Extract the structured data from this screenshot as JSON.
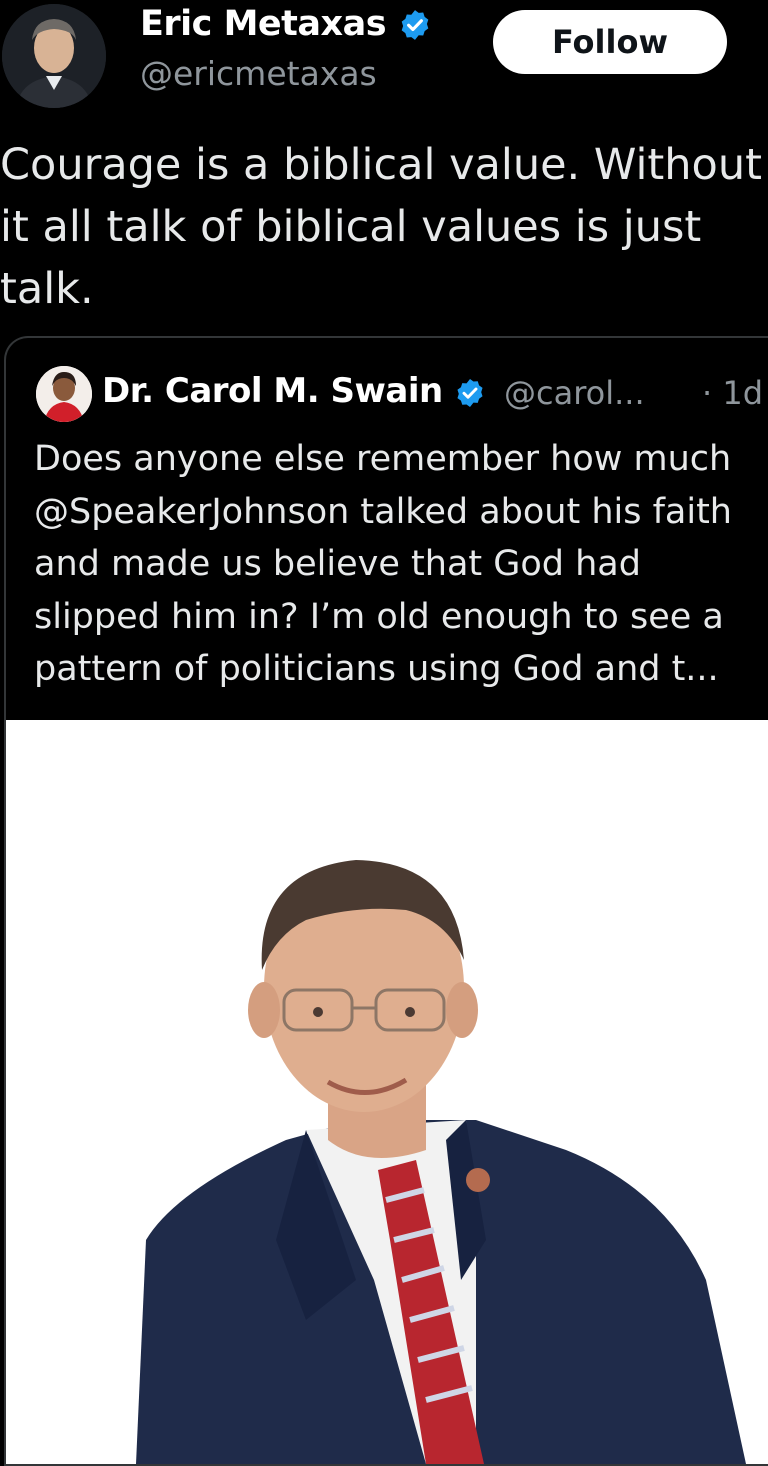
{
  "tweet": {
    "author": "Eric Metaxas",
    "handle": "@ericmetaxas",
    "follow_label": "Follow",
    "text": "Courage is a biblical value. Without it all talk of biblical values is just talk.",
    "verified_color": "#1d9bf0"
  },
  "quoted_tweet": {
    "author": "Dr. Carol M. Swain",
    "handle": "@carol...",
    "time": "· 1d",
    "text": "Does anyone else remember how much @SpeakerJohnson talked about his faith and made us believe that God had slipped him in? I’m old enough to see a pattern of politicians  using God and t..."
  },
  "icons": [
    "verified-badge-icon"
  ],
  "colors": {
    "background": "#000000",
    "text": "#e7e9ea",
    "muted": "#8f969c",
    "follow_bg": "#ffffff"
  }
}
